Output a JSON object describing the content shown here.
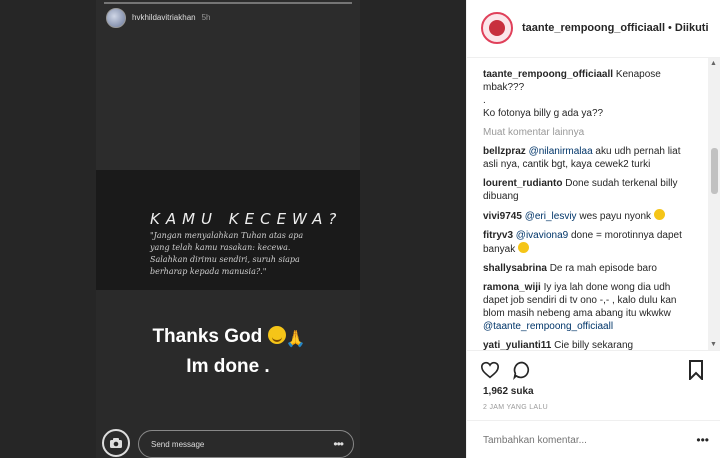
{
  "story": {
    "username": "hvkhildavitriakhan",
    "time": "5h",
    "quote_title": "KAMU KECEWA?",
    "quote_body": "\"Jangan menyalahkan Tuhan atas apa yang telah kamu rasakan: kecewa. Salahkan dirimu sendiri, suruh siapa berharap kepada manusia?.\"",
    "caption_line1": "Thanks God",
    "caption_line2": "Im done .",
    "send_placeholder": "Send message"
  },
  "post": {
    "username": "taante_rempoong_officiaall",
    "separator": "•",
    "follow_label": "Diikuti",
    "likes": "1,962 suka",
    "time": "2 JAM YANG LALU",
    "comment_placeholder": "Tambahkan komentar..."
  },
  "comments": {
    "caption_user": "taante_rempoong_officiaall",
    "caption_text": "Kenapose mbak???",
    "caption_dot": ".",
    "caption_text2": "Ko fotonya billy g ada ya??",
    "load_more": "Muat komentar lainnya",
    "items": [
      {
        "user": "bellzpraz",
        "mention": "@nilanirmalaa",
        "text": " aku udh pernah liat asli nya, cantik bgt, kaya cewek2 turki"
      },
      {
        "user": "lourent_rudianto",
        "mention": "",
        "text": "Done sudah terkenal billy dibuang"
      },
      {
        "user": "vivi9745",
        "mention": "@eri_lesviy",
        "text": " wes payu nyonk"
      },
      {
        "user": "fitryv3",
        "mention": "@ivaviona9",
        "text": " done = morotinnya dapet banyak"
      },
      {
        "user": "shallysabrina",
        "mention": "",
        "text": "De ra mah episode baro"
      },
      {
        "user": "ramona_wiji",
        "mention": "",
        "text": "Iy iya lah done wong dia udh dapet job sendiri di tv ono -,- , kalo dulu kan blom masih nebeng ama abang itu wkwkw "
      },
      {
        "user": "yati_yulianti11",
        "mention": "",
        "text": "Cie billy sekarang"
      }
    ],
    "ramona_mention": "@taante_rempoong_officiaall"
  },
  "icons": {
    "heart": "heart-icon",
    "comment": "comment-icon",
    "bookmark": "bookmark-icon",
    "camera": "camera-icon"
  },
  "colors": {
    "mention": "#003569",
    "story_bg": "#262626",
    "avatar_ring": "#e0405a"
  }
}
